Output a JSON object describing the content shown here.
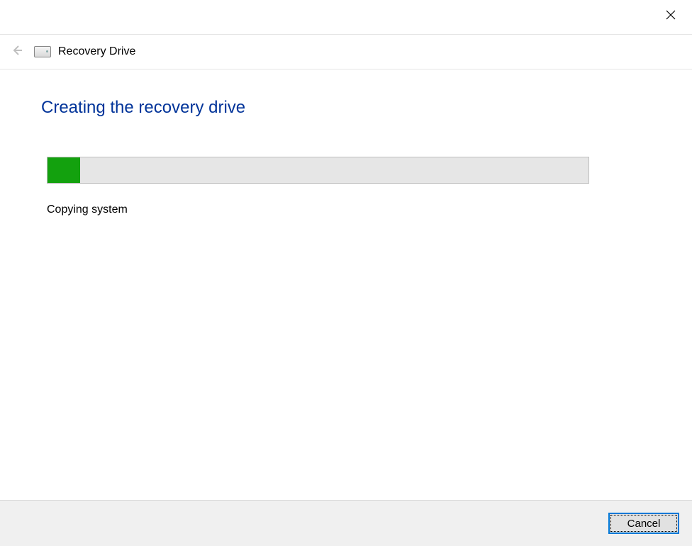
{
  "header": {
    "title": "Recovery Drive"
  },
  "page": {
    "heading": "Creating the recovery drive",
    "progress_percent": 6,
    "status": "Copying system"
  },
  "footer": {
    "cancel_label": "Cancel"
  }
}
